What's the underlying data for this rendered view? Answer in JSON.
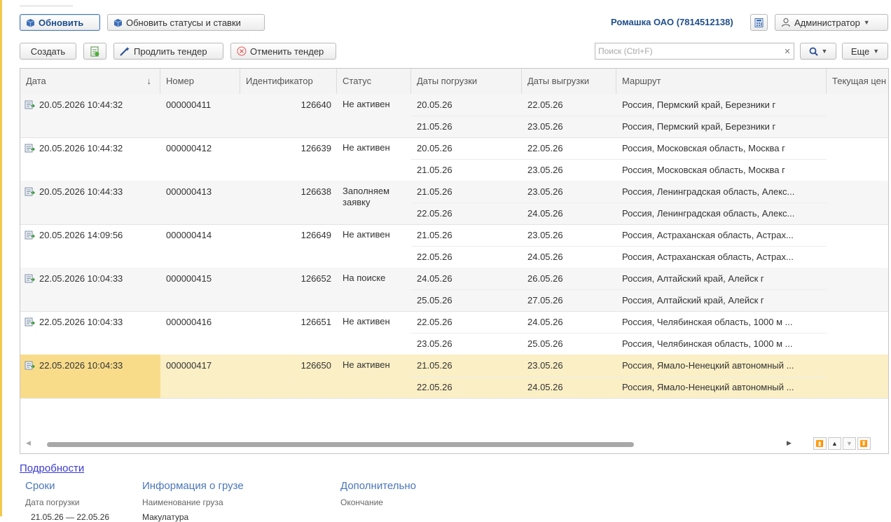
{
  "toolbar1": {
    "refresh_label": "Обновить",
    "refresh_statuses_label": "Обновить статусы и ставки",
    "company": "Ромашка ОАО (7814512138)",
    "user": "Администратор"
  },
  "toolbar2": {
    "create_label": "Создать",
    "extend_label": "Продлить тендер",
    "cancel_label": "Отменить тендер",
    "more_label": "Еще"
  },
  "search": {
    "placeholder": "Поиск (Ctrl+F)",
    "value": ""
  },
  "grid": {
    "headers": [
      "Дата",
      "Номер",
      "Идентификатор",
      "Статус",
      "Даты погрузки",
      "Даты выгрузки",
      "Маршрут",
      "Текущая цен"
    ],
    "rows": [
      {
        "date": "20.05.2026 10:44:32",
        "number": "000000411",
        "id": "126640",
        "status": "Не активен",
        "load1": "20.05.26",
        "unload1": "22.05.26",
        "route1": "Россия, Пермский край, Березники г",
        "load2": "21.05.26",
        "unload2": "23.05.26",
        "route2": "Россия, Пермский край, Березники г"
      },
      {
        "date": "20.05.2026 10:44:32",
        "number": "000000412",
        "id": "126639",
        "status": "Не активен",
        "load1": "20.05.26",
        "unload1": "22.05.26",
        "route1": "Россия, Московская область, Москва г",
        "load2": "21.05.26",
        "unload2": "23.05.26",
        "route2": "Россия, Московская область, Москва г"
      },
      {
        "date": "20.05.2026 10:44:33",
        "number": "000000413",
        "id": "126638",
        "status": "Заполняем заявку",
        "load1": "21.05.26",
        "unload1": "23.05.26",
        "route1": "Россия, Ленинградская область, Алекс...",
        "load2": "22.05.26",
        "unload2": "24.05.26",
        "route2": "Россия, Ленинградская область, Алекс..."
      },
      {
        "date": "20.05.2026 14:09:56",
        "number": "000000414",
        "id": "126649",
        "status": "Не активен",
        "load1": "21.05.26",
        "unload1": "23.05.26",
        "route1": "Россия, Астраханская область, Астрах...",
        "load2": "22.05.26",
        "unload2": "24.05.26",
        "route2": "Россия, Астраханская область, Астрах..."
      },
      {
        "date": "22.05.2026 10:04:33",
        "number": "000000415",
        "id": "126652",
        "status": "На поиске",
        "load1": "24.05.26",
        "unload1": "26.05.26",
        "route1": "Россия, Алтайский край, Алейск г",
        "load2": "25.05.26",
        "unload2": "27.05.26",
        "route2": "Россия, Алтайский край, Алейск г"
      },
      {
        "date": "22.05.2026 10:04:33",
        "number": "000000416",
        "id": "126651",
        "status": "Не активен",
        "load1": "22.05.26",
        "unload1": "24.05.26",
        "route1": "Россия, Челябинская область, 1000 м ...",
        "load2": "23.05.26",
        "unload2": "25.05.26",
        "route2": "Россия, Челябинская область, 1000 м ..."
      },
      {
        "date": "22.05.2026 10:04:33",
        "number": "000000417",
        "id": "126650",
        "status": "Не активен",
        "load1": "21.05.26",
        "unload1": "23.05.26",
        "route1": "Россия, Ямало-Ненецкий автономный ...",
        "load2": "22.05.26",
        "unload2": "24.05.26",
        "route2": "Россия, Ямало-Ненецкий автономный ..."
      }
    ]
  },
  "details": {
    "link": "Подробности",
    "terms_title": "Сроки",
    "terms_label": "Дата погрузки",
    "terms_value": "21.05.26 — 22.05.26",
    "cargo_title": "Информация о грузе",
    "cargo_label": "Наименование груза",
    "cargo_value": "Макулатура",
    "extra_title": "Дополнительно",
    "extra_label": "Окончание"
  },
  "colors": {
    "accent": "#f2c94c",
    "link": "#1f4e8c",
    "selected_row": "#fbefc5"
  }
}
